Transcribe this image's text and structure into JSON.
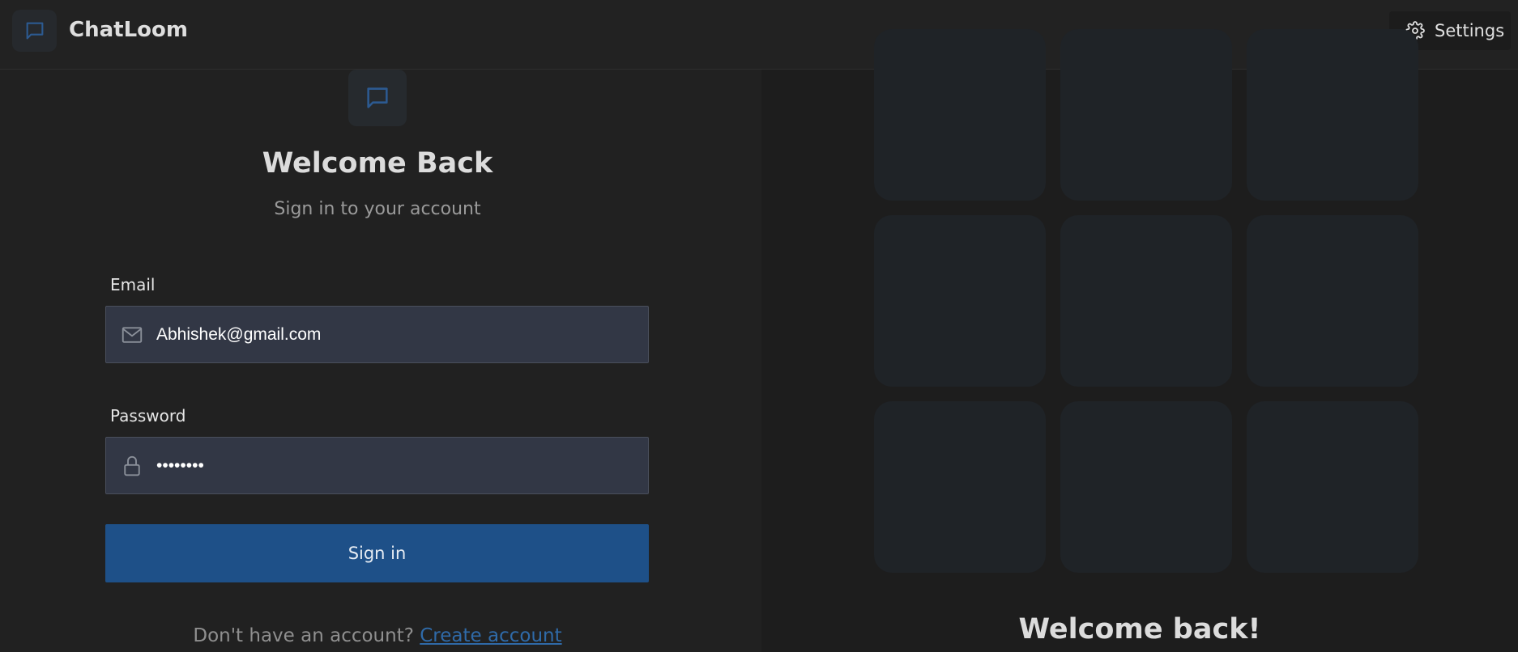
{
  "app": {
    "name": "ChatLoom",
    "settings_label": "Settings"
  },
  "login": {
    "title": "Welcome Back",
    "subtitle": "Sign in to your account",
    "email": {
      "label": "Email",
      "value": "Abhishek@gmail.com",
      "icon": "mail-icon"
    },
    "password": {
      "label": "Password",
      "value": "••••••••",
      "icon": "lock-icon"
    },
    "submit_label": "Sign in",
    "footer": {
      "prompt": "Don't have an account?",
      "link_label": "Create account"
    }
  },
  "side_panel": {
    "tile_count": 9,
    "heading": "Welcome back!"
  },
  "colors": {
    "accent": "#1e5088",
    "link": "#2f6aa8",
    "logo_icon": "#2c5a91",
    "background": "#212121"
  }
}
